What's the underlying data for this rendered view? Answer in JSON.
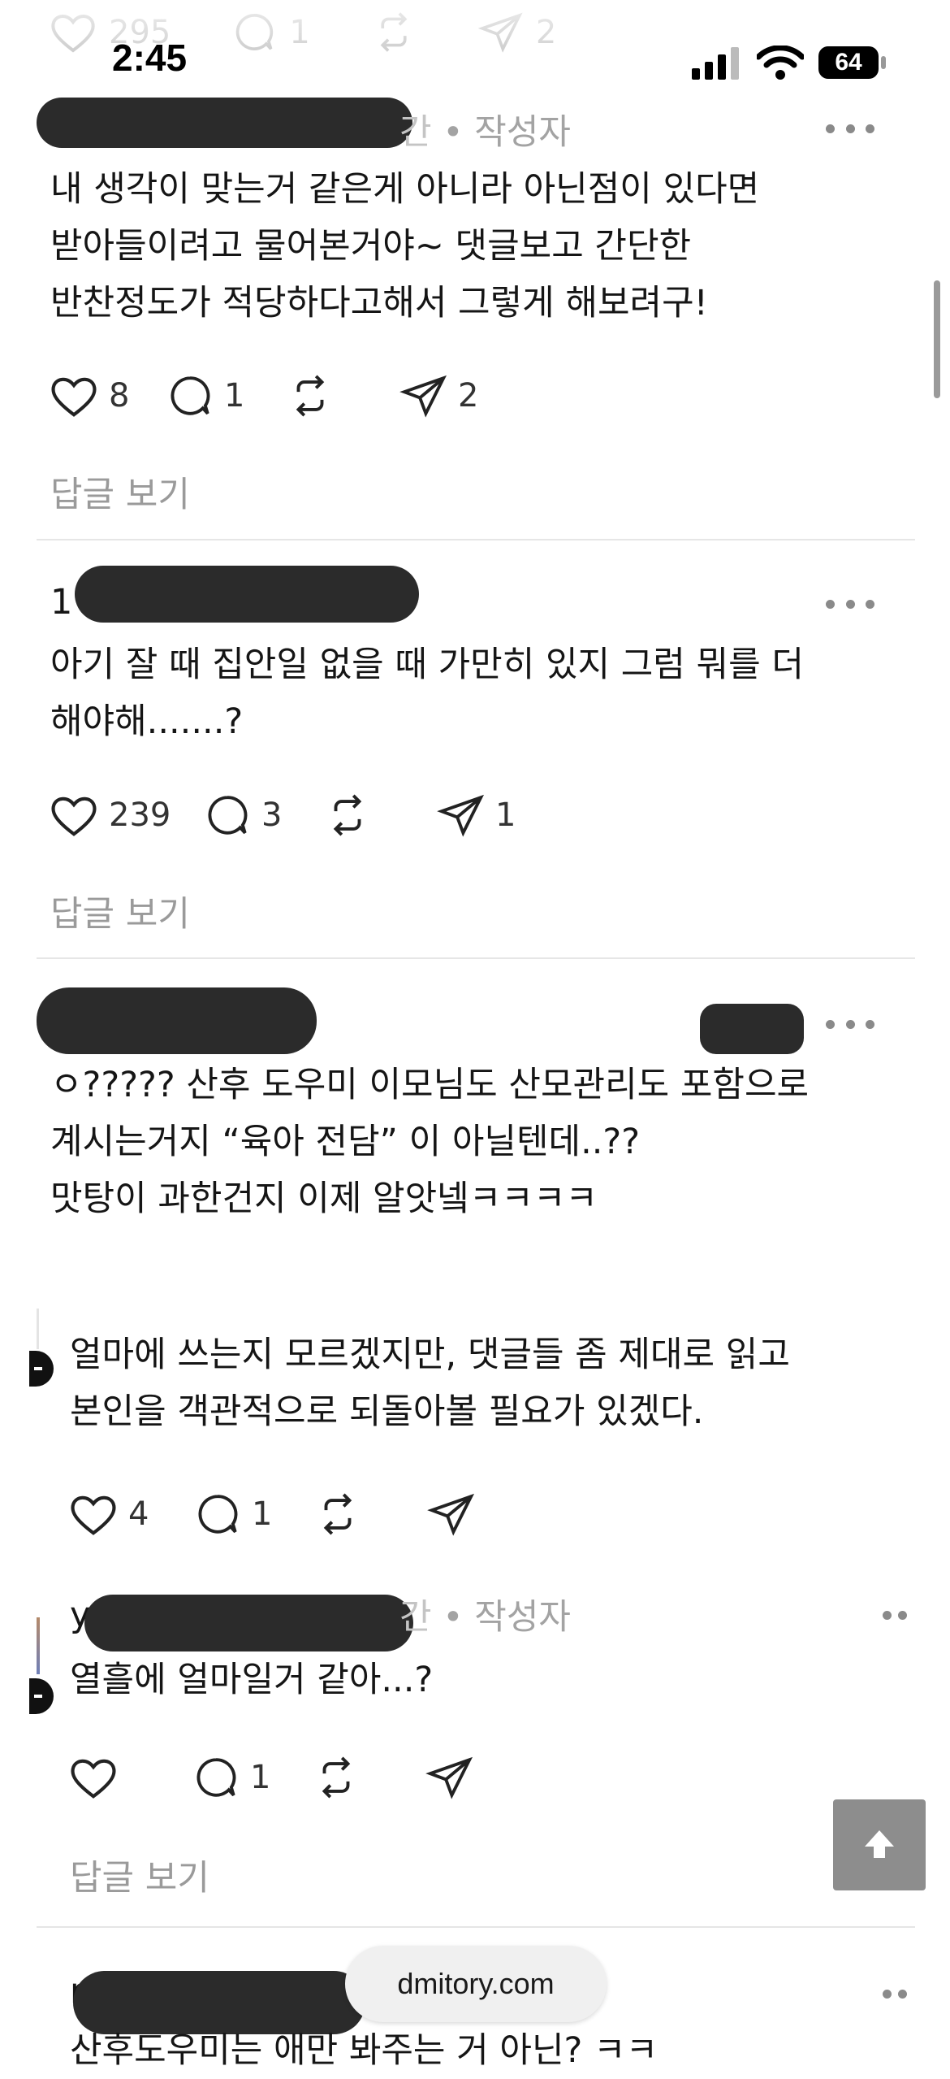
{
  "status_bar": {
    "time": "2:45",
    "battery": "64"
  },
  "top_counts": {
    "likes": "295",
    "comments": "1",
    "shares": "2"
  },
  "comments": [
    {
      "meta_time": "간",
      "meta_author": "• 작성자",
      "lines": [
        "내 생각이 맞는거 같은게 아니라 아닌점이 있다면",
        "받아들이려고 물어본거야~ 댓글보고 간단한",
        "반찬정도가 적당하다고해서 그렇게 해보려구!"
      ],
      "likes": "8",
      "comments": "1",
      "shares": "2",
      "view_replies": "답글 보기"
    },
    {
      "name_prefix": "1",
      "lines": [
        "아기 잘 때 집안일 없을 때 가만히 있지 그럼 뭐를 더",
        "해야해.......?"
      ],
      "likes": "239",
      "comments": "3",
      "shares": "1",
      "view_replies": "답글 보기"
    },
    {
      "lines": [
        "ㅇ????? 산후 도우미 이모님도 산모관리도 포함으로",
        "계시는거지 “육아 전담” 이 아닐텐데..??",
        "맛탕이 과한건지 이제 알앗넼ㅋㅋㅋㅋ"
      ]
    }
  ],
  "replies": [
    {
      "lines": [
        "얼마에 쓰는지 모르겠지만, 댓글들 좀 제대로 읽고",
        "본인을 객관적으로 되돌아볼 필요가 있겠다."
      ],
      "likes": "4",
      "comments": "1"
    },
    {
      "name_prefix": "y",
      "meta_time": "간",
      "meta_author": "• 작성자",
      "lines": [
        "열흘에 얼마일거 같아...?"
      ],
      "comments": "1",
      "view_replies": "답글 보기"
    }
  ],
  "last_comment": {
    "name_prefix": "m",
    "partial_line": "산후도우미는 애만 봐주는 거 아닌? ㅋㅋ"
  },
  "watermark": "dmitory.com",
  "scroll_top_icon": "arrow-up-icon"
}
